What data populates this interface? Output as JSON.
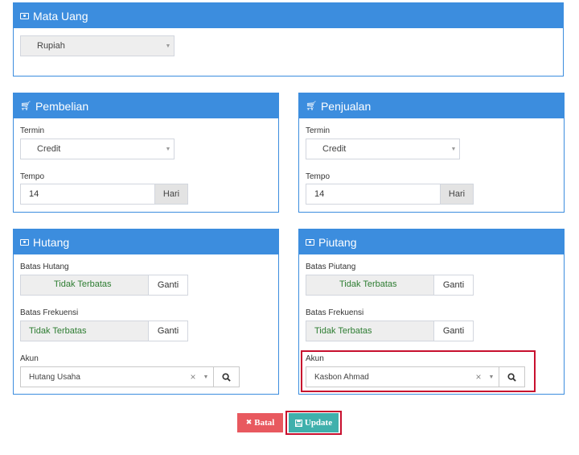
{
  "mata_uang": {
    "title": "Mata Uang",
    "currency_value": "Rupiah"
  },
  "pembelian": {
    "title": "Pembelian",
    "termin_label": "Termin",
    "termin_value": "Credit",
    "tempo_label": "Tempo",
    "tempo_value": "14",
    "tempo_unit": "Hari"
  },
  "penjualan": {
    "title": "Penjualan",
    "termin_label": "Termin",
    "termin_value": "Credit",
    "tempo_label": "Tempo",
    "tempo_value": "14",
    "tempo_unit": "Hari"
  },
  "hutang": {
    "title": "Hutang",
    "batas_label": "Batas Hutang",
    "batas_value": "Tidak Terbatas",
    "batas_button": "Ganti",
    "frekuensi_label": "Batas Frekuensi",
    "frekuensi_value": "Tidak Terbatas",
    "frekuensi_button": "Ganti",
    "akun_label": "Akun",
    "akun_value": "Hutang Usaha"
  },
  "piutang": {
    "title": "Piutang",
    "batas_label": "Batas Piutang",
    "batas_value": "Tidak Terbatas",
    "batas_button": "Ganti",
    "frekuensi_label": "Batas Frekuensi",
    "frekuensi_value": "Tidak Terbatas",
    "frekuensi_button": "Ganti",
    "akun_label": "Akun",
    "akun_value": "Kasbon Ahmad"
  },
  "actions": {
    "cancel_label": "Batal",
    "update_label": "Update"
  },
  "colors": {
    "panel_header": "#3c8dde",
    "cancel": "#e8595f",
    "update": "#3fb0ac",
    "highlight": "#c8102e",
    "green_text": "#2e7d32"
  },
  "icons": {
    "money": "money-icon",
    "cart": "shopping-cart-icon",
    "search": "search-icon",
    "clear": "clear-icon",
    "caret": "caret-down-icon",
    "times": "times-icon",
    "save": "save-icon"
  }
}
